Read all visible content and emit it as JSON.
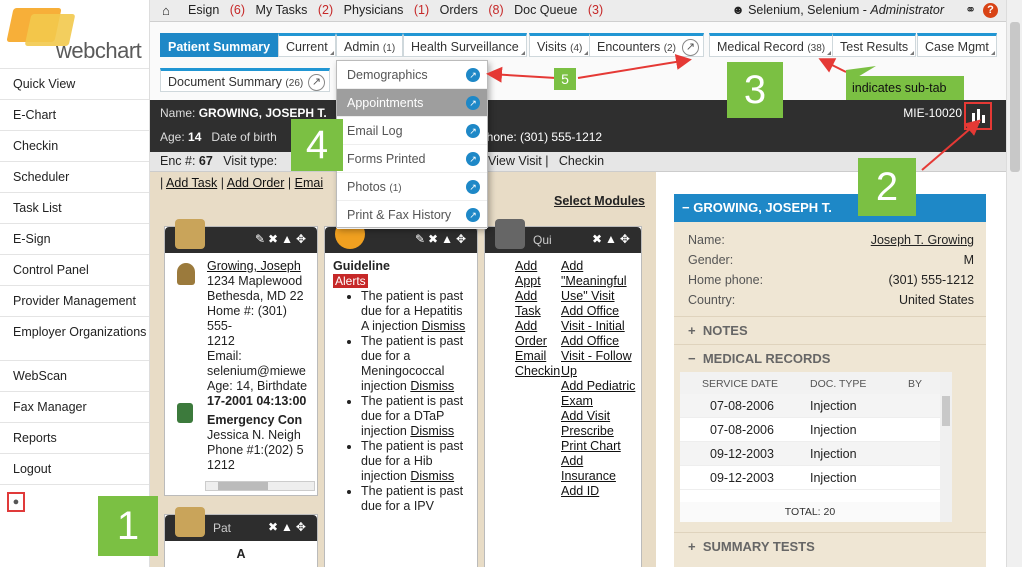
{
  "brand": {
    "logo_text": "webchart",
    "logo_bold": "chart"
  },
  "sidebar": {
    "items": [
      {
        "label": "Quick View"
      },
      {
        "label": "E-Chart"
      },
      {
        "label": "Checkin"
      },
      {
        "label": "Scheduler"
      },
      {
        "label": "Task List"
      },
      {
        "label": "E-Sign"
      },
      {
        "label": "Control Panel"
      },
      {
        "label": "Provider Management"
      },
      {
        "label": "Employer Organizations"
      },
      {
        "label": "WebScan"
      },
      {
        "label": "Fax Manager"
      },
      {
        "label": "Reports"
      },
      {
        "label": "Logout"
      }
    ],
    "pin_icon": "pin-icon"
  },
  "topbar": {
    "items": [
      {
        "label": "Esign",
        "count": "(6)"
      },
      {
        "label": "My Tasks",
        "count": "(2)"
      },
      {
        "label": "Physicians",
        "count": "(1)"
      },
      {
        "label": "Orders",
        "count": "(8)"
      },
      {
        "label": "Doc Queue",
        "count": "(3)"
      }
    ],
    "user_name": "Selenium, Selenium",
    "user_role": "Administrator",
    "help_label": "?"
  },
  "tabs": {
    "patient_summary": "Patient Summary",
    "current": "Current",
    "admin": "Admin",
    "admin_count": "(1)",
    "health_surveillance": "Health Surveillance",
    "visits": "Visits",
    "visits_count": "(4)",
    "encounters": "Encounters",
    "encounters_count": "(2)",
    "medical_record": "Medical Record",
    "medical_record_count": "(38)",
    "test_results": "Test Results",
    "case_mgmt": "Case Mgmt",
    "document_summary": "Document Summary",
    "document_summary_count": "(26)"
  },
  "admin_menu": {
    "items": [
      {
        "label": "Demographics",
        "count": ""
      },
      {
        "label": "Appointments",
        "count": ""
      },
      {
        "label": "Email Log",
        "count": ""
      },
      {
        "label": "Forms Printed",
        "count": ""
      },
      {
        "label": "Photos",
        "count": "(1)"
      },
      {
        "label": "Print & Fax History",
        "count": ""
      }
    ]
  },
  "patient_header": {
    "name_label": "Name:",
    "name": "GROWING, JOSEPH T.",
    "age_label": "Age:",
    "age": "14",
    "dob_label": "Date of birth",
    "phone_label": "phone:",
    "phone": "(301) 555-1212",
    "mie": "MIE-10020"
  },
  "encounter_bar": {
    "enc_label": "Enc #:",
    "enc_number": "67",
    "visit_type_label": "Visit type:",
    "view_visit": "View Visit",
    "checkin": "Checkin"
  },
  "main": {
    "add_task": "Add Task",
    "add_order": "Add Order",
    "email_link": "Emai",
    "select_modules": "Select Modules",
    "demographics_card": {
      "name": "Growing, Joseph",
      "address1": "1234 Maplewood",
      "address2": "Bethesda, MD 22",
      "home_label": "Home #:",
      "home_phone_a": "(301) 555-",
      "home_phone_b": "1212",
      "email_label": "Email:",
      "email": "selenium@miewe",
      "age_line": "Age: 14, Birthdate",
      "dob_time": "17-2001 04:13:00",
      "emergency_title": "Emergency Con",
      "emergency_name": "Jessica N. Neigh",
      "emergency_phone": "Phone #1:(202) 5",
      "emergency_phone_b": "1212"
    },
    "guideline_card": {
      "title": "Guideline",
      "alerts": "Alerts",
      "items": [
        "The patient is past due for a Hepatitis A injection",
        "The patient is past due for a Meningococcal injection",
        "The patient is past due for a DTaP injection",
        "The patient is past due for a Hib injection",
        "The patient is past due for a IPV"
      ],
      "dismiss": "Dismiss"
    },
    "quick_card": {
      "title": "Qui",
      "col1": [
        "Add Appt",
        "Add Task",
        "Add Order",
        "Email",
        "Checkin"
      ],
      "col2": [
        "Add \"Meaningful Use\" Visit",
        "Add Office Visit - Initial",
        "Add Office Visit - Follow Up",
        "Add Pediatric Exam",
        "Add Visit",
        "Prescribe",
        "Print Chart",
        "Add Insurance",
        "Add ID"
      ]
    },
    "bottom_card_title": "Pat",
    "bottom_card_letter": "A"
  },
  "right_panel": {
    "title": "GROWING, JOSEPH T.",
    "fields": [
      {
        "key": "Name:",
        "value": "Joseph T. Growing"
      },
      {
        "key": "Gender:",
        "value": "M"
      },
      {
        "key": "Home phone:",
        "value": "(301) 555-1212"
      },
      {
        "key": "Country:",
        "value": "United States"
      }
    ],
    "notes": "NOTES",
    "medical_records": "MEDICAL RECORDS",
    "summary_tests": "SUMMARY TESTS",
    "table": {
      "headers": [
        "SERVICE DATE",
        "DOC. TYPE",
        "BY"
      ],
      "rows": [
        [
          "07-08-2006",
          "Injection"
        ],
        [
          "07-08-2006",
          "Injection"
        ],
        [
          "09-12-2003",
          "Injection"
        ],
        [
          "09-12-2003",
          "Injection"
        ]
      ],
      "total": "TOTAL: 20"
    }
  },
  "annotations": {
    "c1": "1",
    "c2": "2",
    "c3": "3",
    "c4": "4",
    "c5": "5",
    "subtab_note": "indicates sub-tab"
  },
  "colors": {
    "accent": "#1e88c7",
    "callout_green": "#7bc043",
    "arrow_red": "#e53935",
    "alert_red": "#c62828"
  }
}
